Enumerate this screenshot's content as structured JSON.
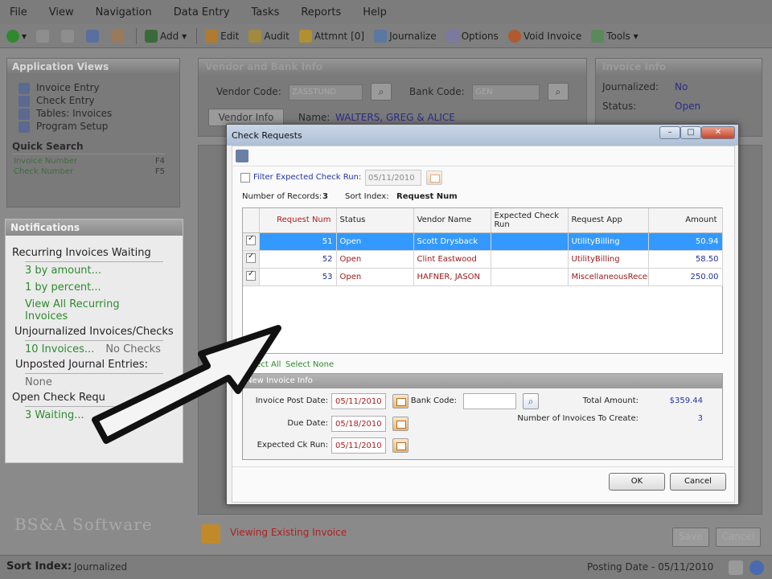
{
  "menu": [
    "File",
    "View",
    "Navigation",
    "Data Entry",
    "Tasks",
    "Reports",
    "Help"
  ],
  "toolbar": {
    "add": "Add",
    "edit": "Edit",
    "audit": "Audit",
    "attmnt": "Attmnt [0]",
    "journalize": "Journalize",
    "options": "Options",
    "void_invoice": "Void Invoice",
    "tools": "Tools"
  },
  "sidebar": {
    "title": "Application Views",
    "items": [
      "Invoice Entry",
      "Check Entry",
      "Tables: Invoices",
      "Program Setup"
    ],
    "quick_search_title": "Quick Search",
    "quick_search": [
      {
        "label": "Invoice Number",
        "key": "F4"
      },
      {
        "label": "Check Number",
        "key": "F5"
      }
    ]
  },
  "notifications": {
    "title": "Notifications",
    "recurring_title": "Recurring Invoices Waiting",
    "by_amount": "3 by amount...",
    "by_percent": "1 by percent...",
    "view_all": "View All Recurring Invoices",
    "unjournalized_title": "Unjournalized Invoices/Checks",
    "invoices_link": "10 Invoices...",
    "no_checks": "No Checks",
    "unposted_title": "Unposted Journal Entries:",
    "none": "None",
    "open_check_title": "Open Check Requ",
    "waiting": "3 Waiting..."
  },
  "logo_text": "BS&A Software",
  "background": {
    "vendor_panel_title": "Vendor and Bank Info",
    "vendor_code_label": "Vendor Code:",
    "vendor_code_value": "ZASSTUND",
    "bank_code_label": "Bank Code:",
    "bank_code_value": "GEN",
    "vendor_info_button": "Vendor Info",
    "name_label": "Name:",
    "name_value": "WALTERS, GREG & ALICE",
    "invoice_panel_title": "Invoice Info",
    "journalized_label": "Journalized:",
    "journalized_value": "No",
    "status_label": "Status:",
    "status_value": "Open",
    "viewing_existing": "Viewing Existing Invoice",
    "save_button": "Save",
    "cancel_button": "Cancel"
  },
  "statusbar": {
    "sort_index_label": "Sort Index:",
    "sort_index_value": "Journalized",
    "posting_date": "Posting Date - 05/11/2010"
  },
  "dialog": {
    "title": "Check Requests",
    "filter_label": "Filter Expected Check Run:",
    "filter_date": "05/11/2010",
    "records_label": "Number of Records:",
    "records_value": "3",
    "sort_index_label": "Sort Index:",
    "sort_index_value": "Request Num",
    "columns": [
      "Request Num",
      "Status",
      "Vendor Name",
      "Expected Check Run",
      "Request App",
      "Amount"
    ],
    "rows": [
      {
        "checked": true,
        "request_num": "51",
        "status": "Open",
        "vendor": "Scott Drysback",
        "expected_run": "",
        "app": "UtilityBilling",
        "amount": "50.94",
        "selected": true
      },
      {
        "checked": true,
        "request_num": "52",
        "status": "Open",
        "vendor": "Clint Eastwood",
        "expected_run": "",
        "app": "UtilityBilling",
        "amount": "58.50",
        "selected": false
      },
      {
        "checked": true,
        "request_num": "53",
        "status": "Open",
        "vendor": "HAFNER, JASON",
        "expected_run": "",
        "app": "MiscellaneousReceivables",
        "amount": "250.00",
        "selected": false
      }
    ],
    "select_all": "Select All",
    "select_none": "Select None",
    "new_invoice_title": "New Invoice Info",
    "invoice_post_date_label": "Invoice Post Date:",
    "invoice_post_date": "05/11/2010",
    "due_date_label": "Due Date:",
    "due_date": "05/18/2010",
    "expected_ck_run_label": "Expected Ck Run:",
    "expected_ck_run": "05/11/2010",
    "bank_code_label": "Bank Code:",
    "bank_code_value": "",
    "total_amount_label": "Total Amount:",
    "total_amount": "$359.44",
    "num_invoices_label": "Number of Invoices To Create:",
    "num_invoices": "3",
    "ok_button": "OK",
    "cancel_button": "Cancel"
  },
  "colors": {
    "accent_blue": "#1f2f9a",
    "selection": "#3399ff",
    "link_green": "#2e8a2e",
    "error_red": "#a01818"
  }
}
